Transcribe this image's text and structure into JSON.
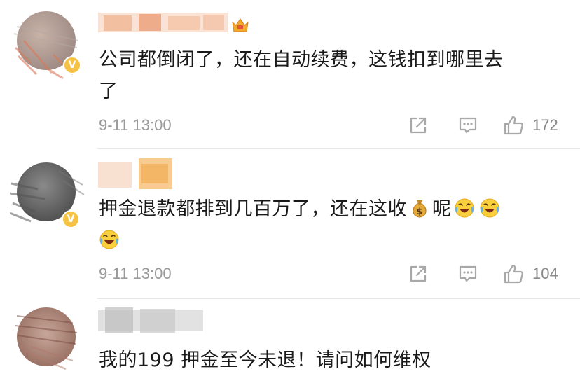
{
  "comments": [
    {
      "text_line1": "公司都倒闭了，还在自动续费，这钱扣到哪里去",
      "text_line2": "了",
      "time": "9-11 13:00",
      "likes": "172",
      "user_badge": "V"
    },
    {
      "text_line1": "押金退款都排到几百万了，还在这收",
      "text_line1_tail": "呢",
      "time": "9-11 13:00",
      "likes": "104",
      "user_badge": "V",
      "emojis": [
        "money-bag-emoji",
        "laughing-crying-emoji",
        "laughing-crying-emoji",
        "laughing-crying-emoji"
      ]
    },
    {
      "text_line1": "我的199 押金至今未退！请问如何维权"
    }
  ],
  "icons": {
    "share": "share-icon",
    "reply": "comment-icon",
    "like": "thumbs-up-icon",
    "vip": "crown-icon"
  },
  "colors": {
    "text": "#1a1a1a",
    "meta": "#9a9a9a",
    "badge": "#f5c244",
    "divider": "#e6e6e6"
  }
}
